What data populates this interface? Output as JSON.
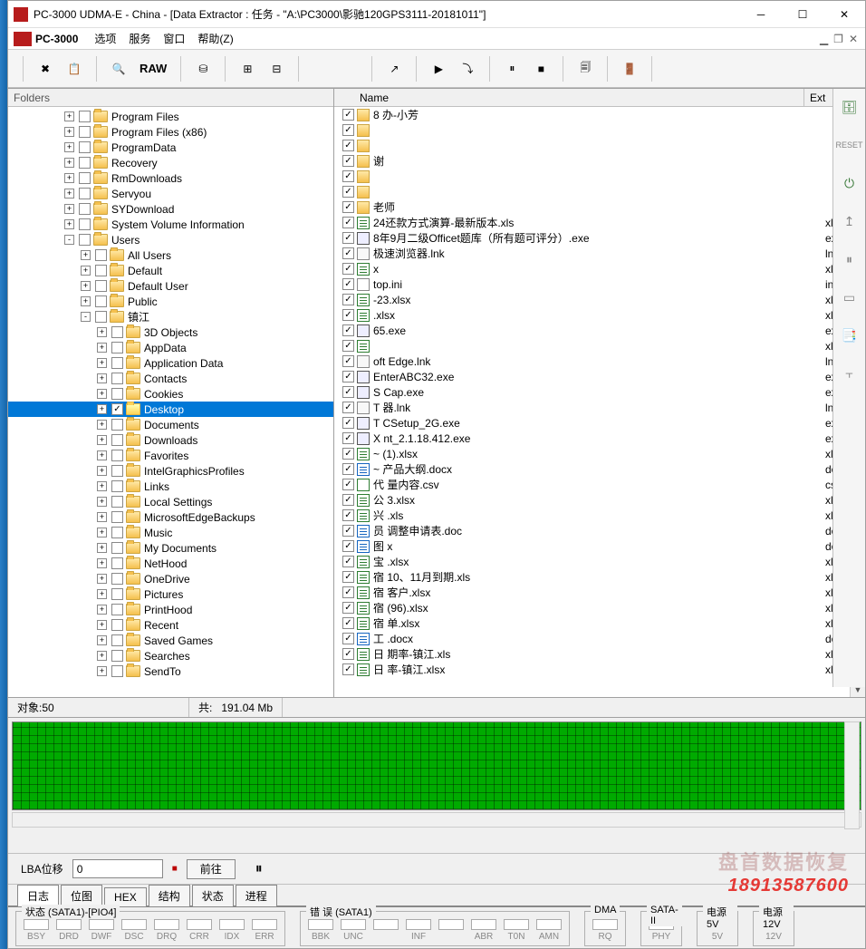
{
  "window": {
    "title": "PC-3000 UDMA-E - China - [Data Extractor : 任务 - \"A:\\PC3000\\影驰120GPS3111-20181011\"]"
  },
  "menubar": {
    "brand": "PC-3000",
    "items": [
      "选项",
      "服务",
      "窗口",
      "帮助(Z)"
    ]
  },
  "toolbar": {
    "raw": "RAW"
  },
  "left_panel": {
    "header": "Folders"
  },
  "tree": [
    {
      "indent": 3,
      "expand": "+",
      "checked": false,
      "label": "Program Files"
    },
    {
      "indent": 3,
      "expand": "+",
      "checked": false,
      "label": "Program Files (x86)"
    },
    {
      "indent": 3,
      "expand": "+",
      "checked": false,
      "label": "ProgramData"
    },
    {
      "indent": 3,
      "expand": "+",
      "checked": false,
      "label": "Recovery"
    },
    {
      "indent": 3,
      "expand": "+",
      "checked": false,
      "label": "RmDownloads"
    },
    {
      "indent": 3,
      "expand": "+",
      "checked": false,
      "label": "Servyou"
    },
    {
      "indent": 3,
      "expand": "+",
      "checked": false,
      "label": "SYDownload"
    },
    {
      "indent": 3,
      "expand": "+",
      "checked": false,
      "label": "System Volume Information"
    },
    {
      "indent": 3,
      "expand": "-",
      "checked": false,
      "label": "Users"
    },
    {
      "indent": 4,
      "expand": "+",
      "checked": false,
      "label": "All Users"
    },
    {
      "indent": 4,
      "expand": "+",
      "checked": false,
      "label": "Default"
    },
    {
      "indent": 4,
      "expand": "+",
      "checked": false,
      "label": "Default User"
    },
    {
      "indent": 4,
      "expand": "+",
      "checked": false,
      "label": "Public"
    },
    {
      "indent": 4,
      "expand": "-",
      "checked": false,
      "label": "镇江"
    },
    {
      "indent": 5,
      "expand": "+",
      "checked": false,
      "label": "3D Objects"
    },
    {
      "indent": 5,
      "expand": "+",
      "checked": false,
      "label": "AppData"
    },
    {
      "indent": 5,
      "expand": "+",
      "checked": false,
      "label": "Application Data"
    },
    {
      "indent": 5,
      "expand": "+",
      "checked": false,
      "label": "Contacts"
    },
    {
      "indent": 5,
      "expand": "+",
      "checked": false,
      "label": "Cookies"
    },
    {
      "indent": 5,
      "expand": "+",
      "checked": true,
      "label": "Desktop",
      "selected": true
    },
    {
      "indent": 5,
      "expand": "+",
      "checked": false,
      "label": "Documents"
    },
    {
      "indent": 5,
      "expand": "+",
      "checked": false,
      "label": "Downloads"
    },
    {
      "indent": 5,
      "expand": "+",
      "checked": false,
      "label": "Favorites"
    },
    {
      "indent": 5,
      "expand": "+",
      "checked": false,
      "label": "IntelGraphicsProfiles"
    },
    {
      "indent": 5,
      "expand": "+",
      "checked": false,
      "label": "Links"
    },
    {
      "indent": 5,
      "expand": "+",
      "checked": false,
      "label": "Local Settings"
    },
    {
      "indent": 5,
      "expand": "+",
      "checked": false,
      "label": "MicrosoftEdgeBackups"
    },
    {
      "indent": 5,
      "expand": "+",
      "checked": false,
      "label": "Music"
    },
    {
      "indent": 5,
      "expand": "+",
      "checked": false,
      "label": "My Documents"
    },
    {
      "indent": 5,
      "expand": "+",
      "checked": false,
      "label": "NetHood"
    },
    {
      "indent": 5,
      "expand": "+",
      "checked": false,
      "label": "OneDrive"
    },
    {
      "indent": 5,
      "expand": "+",
      "checked": false,
      "label": "Pictures"
    },
    {
      "indent": 5,
      "expand": "+",
      "checked": false,
      "label": "PrintHood"
    },
    {
      "indent": 5,
      "expand": "+",
      "checked": false,
      "label": "Recent"
    },
    {
      "indent": 5,
      "expand": "+",
      "checked": false,
      "label": "Saved Games"
    },
    {
      "indent": 5,
      "expand": "+",
      "checked": false,
      "label": "Searches"
    },
    {
      "indent": 5,
      "expand": "+",
      "checked": false,
      "label": "SendTo"
    }
  ],
  "list": {
    "col_name": "Name",
    "col_ext": "Ext",
    "rows": [
      {
        "checked": true,
        "icon": "folder",
        "name": "8███办-小芳",
        "ext": ""
      },
      {
        "checked": true,
        "icon": "folder",
        "name": "████",
        "ext": ""
      },
      {
        "checked": true,
        "icon": "folder",
        "name": "████",
        "ext": ""
      },
      {
        "checked": true,
        "icon": "folder",
        "name": "███谢",
        "ext": ""
      },
      {
        "checked": true,
        "icon": "folder",
        "name": "██",
        "ext": ""
      },
      {
        "checked": true,
        "icon": "folder",
        "name": "████",
        "ext": ""
      },
      {
        "checked": true,
        "icon": "folder",
        "name": "██老师",
        "ext": ""
      },
      {
        "checked": true,
        "icon": "xls",
        "name": "██24还款方式演算-最新版本.xls",
        "ext": "xls"
      },
      {
        "checked": true,
        "icon": "exe",
        "name": "██8年9月二级Officet题库（所有题可评分）.exe",
        "ext": "exe"
      },
      {
        "checked": true,
        "icon": "lnk",
        "name": "██极速浏览器.lnk",
        "ext": "lnk"
      },
      {
        "checked": true,
        "icon": "xls",
        "name": "██x",
        "ext": "xlsx"
      },
      {
        "checked": true,
        "icon": "ini",
        "name": "██top.ini",
        "ext": "ini"
      },
      {
        "checked": true,
        "icon": "xls",
        "name": "██-23.xlsx",
        "ext": "xlsx"
      },
      {
        "checked": true,
        "icon": "xls",
        "name": "██.xlsx",
        "ext": "xlsx"
      },
      {
        "checked": true,
        "icon": "exe",
        "name": "██65.exe",
        "ext": "exe"
      },
      {
        "checked": true,
        "icon": "xls",
        "name": "████",
        "ext": "xlsx"
      },
      {
        "checked": true,
        "icon": "lnk",
        "name": "██oft Edge.lnk",
        "ext": "lnk"
      },
      {
        "checked": true,
        "icon": "exe",
        "name": "██EnterABC32.exe",
        "ext": "exe"
      },
      {
        "checked": true,
        "icon": "exe",
        "name": "S██Cap.exe",
        "ext": "exe"
      },
      {
        "checked": true,
        "icon": "lnk",
        "name": "T██器.lnk",
        "ext": "lnk"
      },
      {
        "checked": true,
        "icon": "exe",
        "name": "T██CSetup_2G.exe",
        "ext": "exe"
      },
      {
        "checked": true,
        "icon": "exe",
        "name": "X██nt_2.1.18.412.exe",
        "ext": "exe"
      },
      {
        "checked": true,
        "icon": "xls",
        "name": "~██ (1).xlsx",
        "ext": "xlsx"
      },
      {
        "checked": true,
        "icon": "doc",
        "name": "~██产品大纲.docx",
        "ext": "doc"
      },
      {
        "checked": true,
        "icon": "csv",
        "name": "代██量内容.csv",
        "ext": "csv"
      },
      {
        "checked": true,
        "icon": "xls",
        "name": "公██3.xlsx",
        "ext": "xlsx"
      },
      {
        "checked": true,
        "icon": "xls",
        "name": "兴██.xls",
        "ext": "xls"
      },
      {
        "checked": true,
        "icon": "doc",
        "name": "员██调整申请表.doc",
        "ext": "doc"
      },
      {
        "checked": true,
        "icon": "doc",
        "name": "图██x",
        "ext": "doc"
      },
      {
        "checked": true,
        "icon": "xls",
        "name": "宝██.xlsx",
        "ext": "xlsx"
      },
      {
        "checked": true,
        "icon": "xls",
        "name": "宿██10、11月到期.xls",
        "ext": "xls"
      },
      {
        "checked": true,
        "icon": "xls",
        "name": "宿██客户.xlsx",
        "ext": "xlsx"
      },
      {
        "checked": true,
        "icon": "xls",
        "name": "宿██(96).xlsx",
        "ext": "xlsx"
      },
      {
        "checked": true,
        "icon": "xls",
        "name": "宿██单.xlsx",
        "ext": "xlsx"
      },
      {
        "checked": true,
        "icon": "doc",
        "name": "工██.docx",
        "ext": "doc"
      },
      {
        "checked": true,
        "icon": "xls",
        "name": "日██期率-镇江.xls",
        "ext": "xls"
      },
      {
        "checked": true,
        "icon": "xls",
        "name": "日██率-镇江.xlsx",
        "ext": "xlsx"
      }
    ]
  },
  "status": {
    "objects_label": "对象:",
    "objects_value": "50",
    "total_label": "共:",
    "total_value": "191.04 Mb"
  },
  "lba": {
    "label": "LBA位移",
    "value": "0",
    "goto": "前往",
    "pause": "⏸"
  },
  "watermark": {
    "line1": "盘首数据恢复",
    "line2": "18913587600"
  },
  "tabs": [
    "日志",
    "位图",
    "HEX",
    "结构",
    "状态",
    "进程"
  ],
  "bottom": {
    "g1_label": "状态 (SATA1)-[PIO4]",
    "g1": [
      "BSY",
      "DRD",
      "DWF",
      "DSC",
      "DRQ",
      "CRR",
      "IDX",
      "ERR"
    ],
    "g2_label": "错 误 (SATA1)",
    "g2": [
      "BBK",
      "UNC",
      "",
      "INF",
      "",
      "ABR",
      "T0N",
      "AMN"
    ],
    "g3_label": "DMA",
    "g3": [
      "RQ"
    ],
    "g4_label": "SATA-II",
    "g4": [
      "PHY"
    ],
    "g5_label": "电源 5V",
    "g5": [
      "5V"
    ],
    "g6_label": "电源 12V",
    "g6": [
      "12V"
    ]
  }
}
